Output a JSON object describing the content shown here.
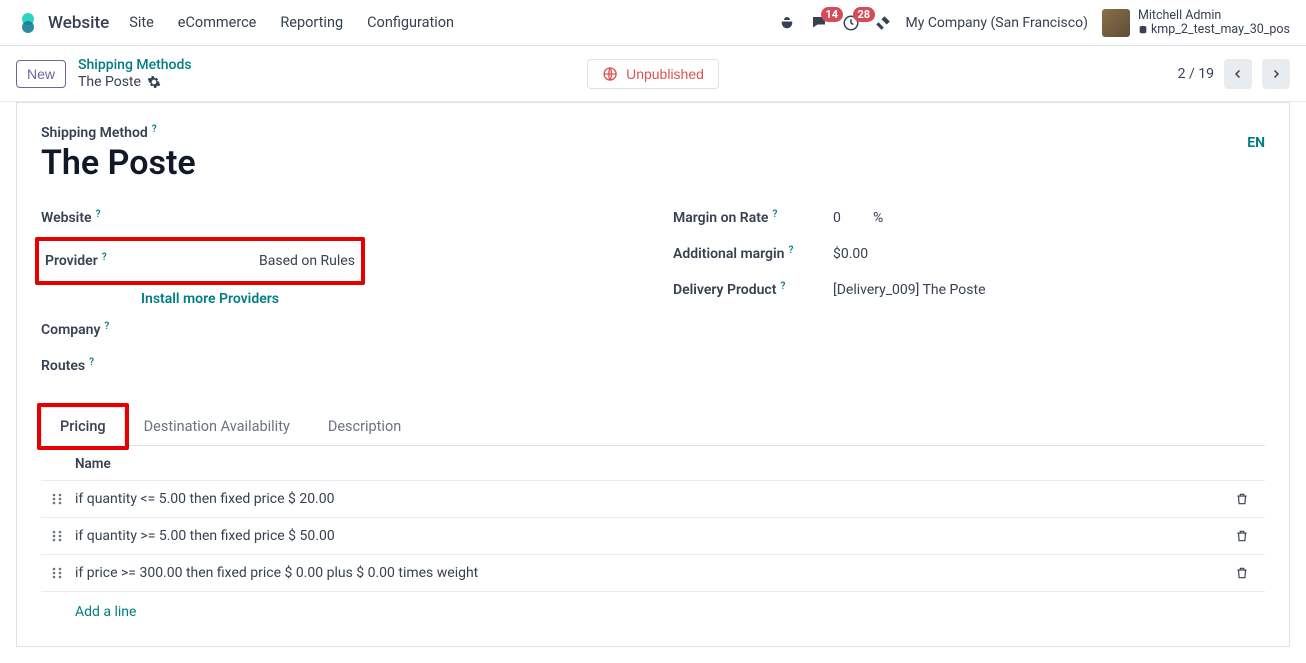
{
  "topnav": {
    "app": "Website",
    "menu": [
      "Site",
      "eCommerce",
      "Reporting",
      "Configuration"
    ],
    "msg_badge": "14",
    "activity_badge": "28",
    "company": "My Company (San Francisco)",
    "user_name": "Mitchell Admin",
    "user_db": "kmp_2_test_may_30_pos"
  },
  "subbar": {
    "new": "New",
    "bc_top": "Shipping Methods",
    "bc_bottom": "The Poste",
    "unpublished": "Unpublished",
    "pager": "2 / 19"
  },
  "form": {
    "shipping_method_label": "Shipping Method",
    "title": "The Poste",
    "lang": "EN",
    "left": {
      "website_label": "Website",
      "provider_label": "Provider",
      "provider_value": "Based on Rules",
      "install_more": "Install more Providers",
      "company_label": "Company",
      "routes_label": "Routes"
    },
    "right": {
      "margin_rate_label": "Margin on Rate",
      "margin_rate_value": "0",
      "margin_rate_unit": "%",
      "add_margin_label": "Additional margin",
      "add_margin_value": "$0.00",
      "delivery_product_label": "Delivery Product",
      "delivery_product_value": "[Delivery_009] The Poste"
    }
  },
  "tabs": {
    "pricing": "Pricing",
    "dest": "Destination Availability",
    "desc": "Description"
  },
  "pricing_grid": {
    "header_name": "Name",
    "rows": [
      "if quantity <= 5.00 then fixed price $ 20.00",
      "if quantity >= 5.00 then fixed price $ 50.00",
      "if price >= 300.00 then fixed price $ 0.00 plus $ 0.00 times weight"
    ],
    "add_line": "Add a line"
  }
}
